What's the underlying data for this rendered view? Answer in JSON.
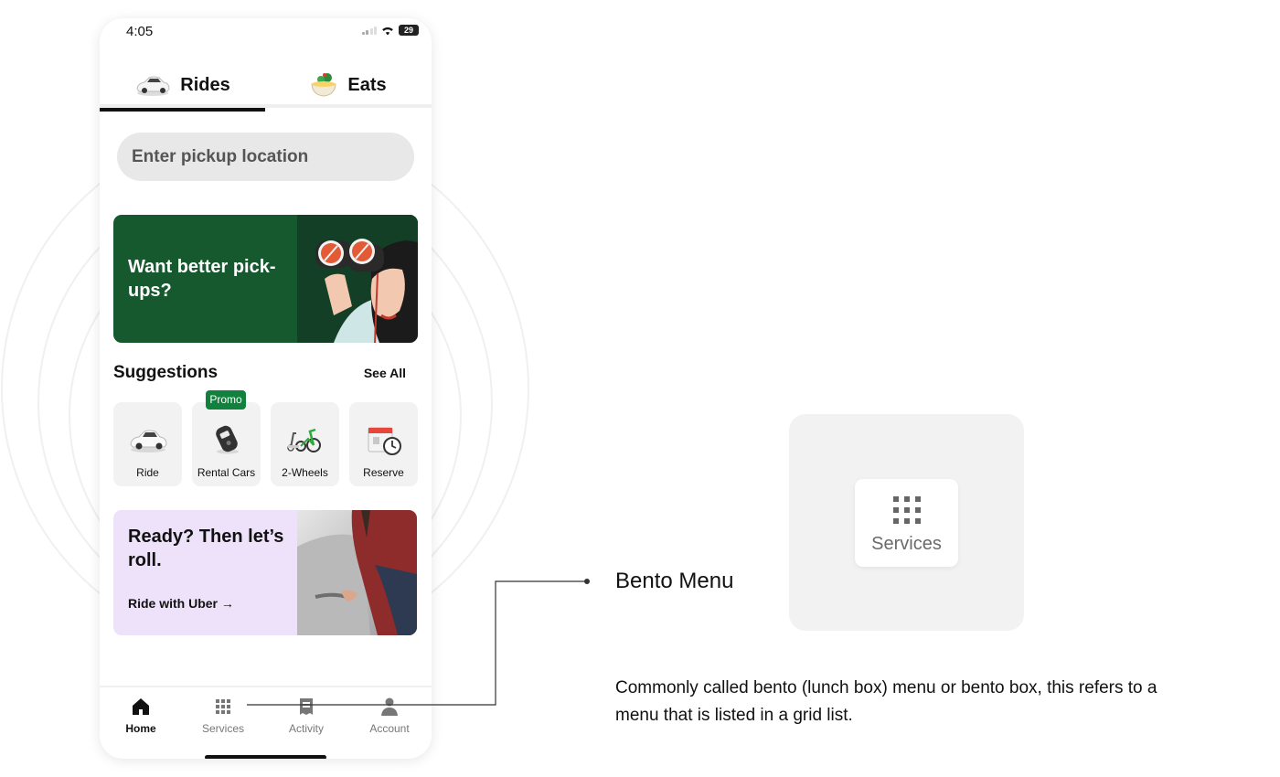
{
  "status_bar": {
    "time": "4:05",
    "battery": "29"
  },
  "tabs": [
    {
      "label": "Rides",
      "icon": "car-icon",
      "active": true
    },
    {
      "label": "Eats",
      "icon": "food-bowl-icon",
      "active": false
    }
  ],
  "search": {
    "placeholder": "Enter pickup location"
  },
  "promo_card": {
    "text": "Want better pick-ups?",
    "image": "binoculars-illustration"
  },
  "suggestions": {
    "title": "Suggestions",
    "see_all": "See All",
    "items": [
      {
        "label": "Ride",
        "icon": "car-icon"
      },
      {
        "label": "Rental Cars",
        "icon": "car-key-icon",
        "badge": "Promo"
      },
      {
        "label": "2-Wheels",
        "icon": "scooter-bike-icon"
      },
      {
        "label": "Reserve",
        "icon": "calendar-clock-icon"
      }
    ]
  },
  "roll_card": {
    "title": "Ready? Then let’s roll.",
    "link": "Ride with Uber →",
    "image": "car-door-photo"
  },
  "bottom_nav": [
    {
      "label": "Home",
      "icon": "home-icon",
      "active": true
    },
    {
      "label": "Services",
      "icon": "grid-icon",
      "active": false
    },
    {
      "label": "Activity",
      "icon": "receipt-icon",
      "active": false
    },
    {
      "label": "Account",
      "icon": "person-icon",
      "active": false
    }
  ],
  "callout": {
    "title": "Bento Menu",
    "description": "Commonly called bento (lunch box) menu or bento box, this refers to a menu that is listed in a grid list.",
    "zoom_label": "Services",
    "zoom_icon": "grid-icon"
  },
  "colors": {
    "promo_green": "#17592f",
    "badge_green": "#12813e",
    "roll_lilac": "#ede2fa",
    "search_bg": "#e8e8e8"
  }
}
